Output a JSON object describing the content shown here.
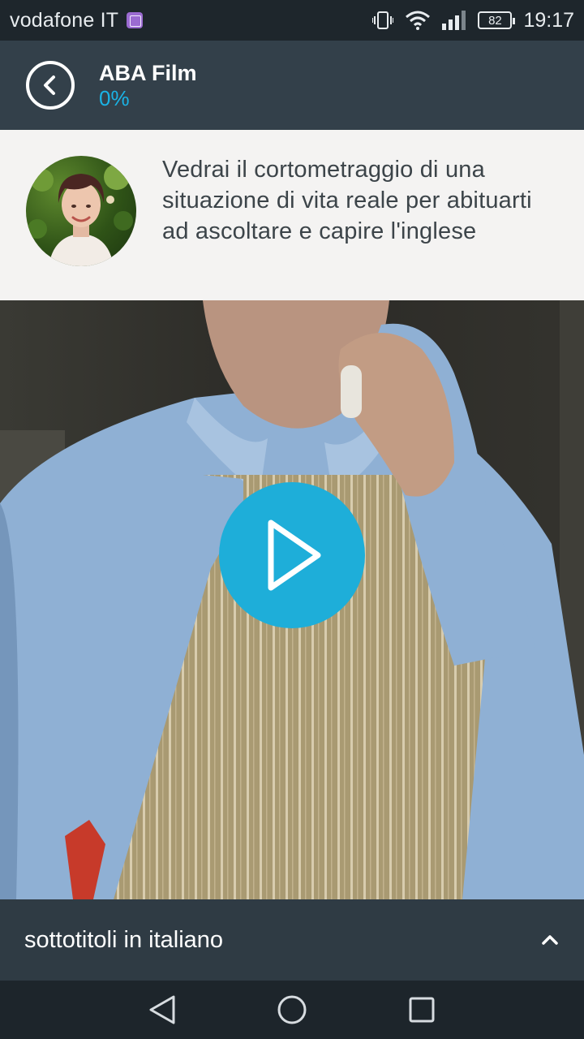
{
  "status_bar": {
    "carrier": "vodafone IT",
    "battery": "82",
    "time": "19:17"
  },
  "header": {
    "title": "ABA Film",
    "progress": "0%"
  },
  "intro": {
    "text": "Vedrai il cortometraggio di una situazione di vita reale per abituarti ad ascoltare e capire l'inglese"
  },
  "subtitles": {
    "label": "sottotitoli in italiano"
  },
  "colors": {
    "accent": "#1eaed9",
    "header_bg": "#33404a",
    "status_bg": "#1e262c",
    "intro_bg": "#f4f3f2"
  }
}
